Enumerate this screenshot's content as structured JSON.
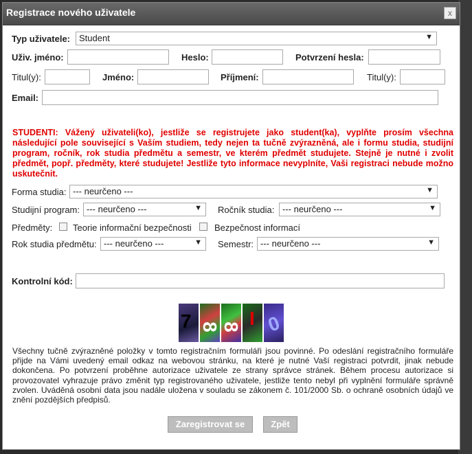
{
  "dialog": {
    "title": "Registrace nového uživatele",
    "close_label": "x"
  },
  "form": {
    "user_type": {
      "label": "Typ uživatele:",
      "value": "Student"
    },
    "username_label": "Uživ. jméno:",
    "password_label": "Heslo:",
    "password_confirm_label": "Potvrzení hesla:",
    "title_before_label": "Titul(y):",
    "firstname_label": "Jméno:",
    "lastname_label": "Příjmení:",
    "title_after_label": "Titul(y):",
    "email_label": "Email:",
    "warning": "STUDENTI: Vážený uživateli(ko), jestliže se registrujete jako student(ka), vyplňte prosím všechna následující pole související s Vaším studiem, tedy nejen ta tučně zvýrazněná, ale i formu studia, studijní program, ročník, rok studia předmětu a semestr, ve kterém předmět studujete. Stejně je nutné i zvolit předmět, popř. předměty, které studujete! Jestliže tyto informace nevyplníte, Vaši registraci nebude možno uskutečnit.",
    "study_form": {
      "label": "Forma studia:",
      "value": "--- neurčeno ---"
    },
    "program": {
      "label": "Studijní program:",
      "value": "--- neurčeno ---"
    },
    "year_of_study": {
      "label": "Ročník studia:",
      "value": "--- neurčeno ---"
    },
    "subjects_label": "Předměty:",
    "subjects": [
      "Teorie informační bezpečnosti",
      "Bezpečnost informací"
    ],
    "subject_year": {
      "label": "Rok studia předmětu:",
      "value": "--- neurčeno ---"
    },
    "semester": {
      "label": "Semestr:",
      "value": "--- neurčeno ---"
    },
    "control_code_label": "Kontrolní kód:",
    "captcha_chars": [
      "7",
      "8",
      "8",
      "I",
      "0"
    ],
    "info": "Všechny tučně zvýrazněné položky v tomto registračním formuláři jsou povinné. Po odeslání registračního formuláře přijde na Vámi uvedený email odkaz na webovou stránku, na které je nutné Vaší registraci potvrdit, jinak nebude dokončena. Po potvrzení proběhne autorizace uživatele ze strany správce stránek. Během procesu autorizace si provozovatel vyhrazuje právo změnit typ registrovaného uživatele, jestliže tento nebyl při vyplnění formuláře správně zvolen. Uváděná osobní data jsou nadále uložena v souladu se zákonem č. 101/2000 Sb. o ochraně osobních údajů ve znění pozdějších předpisů.",
    "submit_label": "Zaregistrovat se",
    "back_label": "Zpět"
  }
}
